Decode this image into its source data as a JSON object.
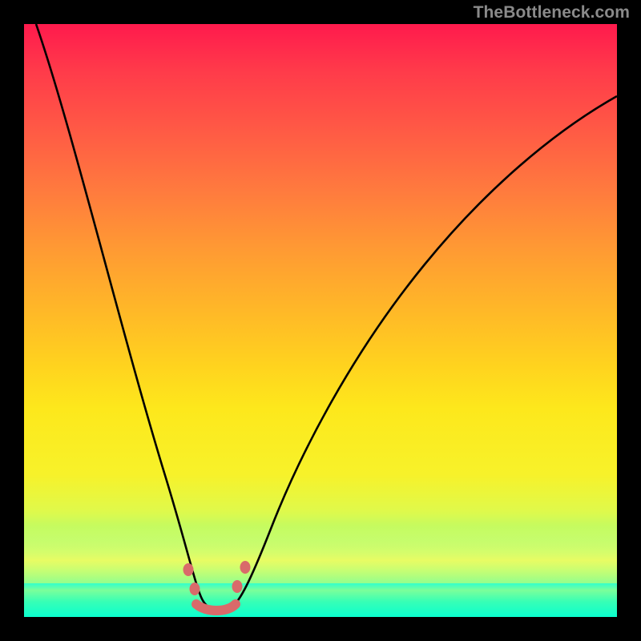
{
  "attribution": "TheBottleneck.com",
  "chart_data": {
    "type": "line",
    "title": "",
    "xlabel": "",
    "ylabel": "",
    "xlim": [
      0,
      100
    ],
    "ylim": [
      0,
      100
    ],
    "series": [
      {
        "name": "curve",
        "x": [
          2,
          6,
          10,
          14,
          18,
          22,
          24,
          26,
          28,
          29,
          30,
          31,
          32,
          33,
          34,
          35,
          36,
          38,
          40,
          44,
          50,
          56,
          64,
          72,
          80,
          88,
          96,
          100
        ],
        "y": [
          100,
          87,
          74,
          62,
          49,
          35,
          28,
          20,
          12,
          7,
          3,
          1.5,
          1,
          1,
          1.5,
          3,
          6,
          12,
          18,
          28,
          40,
          49,
          58,
          64,
          69,
          73,
          76,
          77
        ]
      }
    ],
    "markers": [
      {
        "name": "bump-left-a",
        "x": 27.0,
        "y": 8.0
      },
      {
        "name": "bump-left-b",
        "x": 28.2,
        "y": 4.0
      },
      {
        "name": "bump-right-a",
        "x": 35.8,
        "y": 4.0
      },
      {
        "name": "bump-right-b",
        "x": 37.2,
        "y": 8.0
      }
    ],
    "trough_band": {
      "x_start": 29,
      "x_end": 35,
      "y": 1.2
    },
    "gradient_stops": [
      {
        "pos": 0,
        "color": "#ff1a4d"
      },
      {
        "pos": 50,
        "color": "#ffcc22"
      },
      {
        "pos": 75,
        "color": "#f7f22a"
      },
      {
        "pos": 100,
        "color": "#0bffcf"
      }
    ]
  }
}
